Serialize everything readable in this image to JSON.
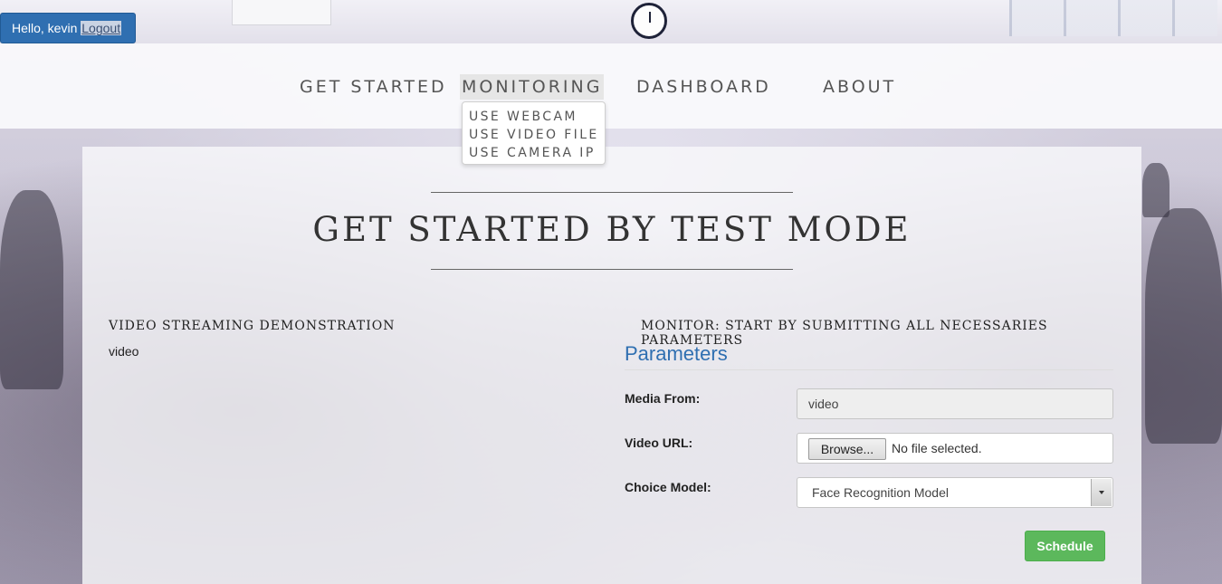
{
  "user": {
    "greeting": "Hello, kevin",
    "logout_label": "Logout"
  },
  "nav": {
    "items": [
      {
        "label": "GET STARTED"
      },
      {
        "label": "MONITORING"
      },
      {
        "label": "DASHBOARD"
      },
      {
        "label": "ABOUT"
      }
    ],
    "active": "MONITORING",
    "dropdown": [
      {
        "label": "USE WEBCAM"
      },
      {
        "label": "USE VIDEO FILE"
      },
      {
        "label": "USE CAMERA IP"
      }
    ]
  },
  "main": {
    "title": "GET STARTED BY TEST MODE",
    "left": {
      "heading": "VIDEO STREAMING DEMONSTRATION",
      "content": "video"
    },
    "right": {
      "heading": "MONITOR: START BY SUBMITTING ALL NECESSARIES PARAMETERS",
      "params_title": "Parameters",
      "fields": {
        "media_from": {
          "label": "Media From:",
          "value": "video"
        },
        "video_url": {
          "label": "Video URL:",
          "browse_label": "Browse...",
          "file_status": "No file selected."
        },
        "choice_model": {
          "label": "Choice Model:",
          "value": "Face Recognition Model"
        }
      },
      "schedule_label": "Schedule"
    }
  },
  "colors": {
    "accent_blue": "#2f6fb1",
    "success_green": "#5cb85c"
  }
}
